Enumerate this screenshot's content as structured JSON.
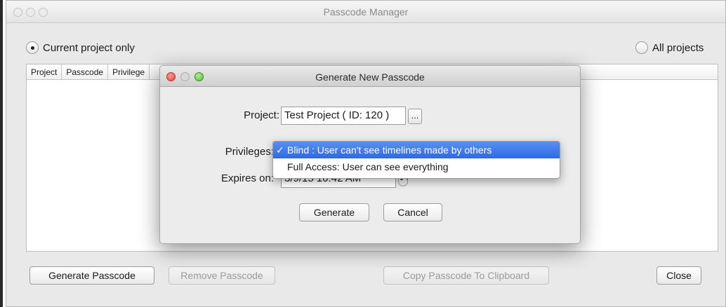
{
  "main": {
    "title": "Passcode Manager",
    "radio_current": "Current project only",
    "radio_all": "All projects",
    "columns": [
      "Project",
      "Passcode",
      "Privilege"
    ],
    "buttons": {
      "generate": "Generate Passcode",
      "remove": "Remove Passcode",
      "copy": "Copy Passcode To Clipboard",
      "close": "Close"
    }
  },
  "dialog": {
    "title": "Generate New Passcode",
    "project_label": "Project:",
    "project_value": "Test Project ( ID: 120 )",
    "ellipsis": "...",
    "privileges_label": "Privileges:",
    "expires_label": "Expires on:",
    "expires_value": "3/9/15 10:42 AM",
    "generate_btn": "Generate",
    "cancel_btn": "Cancel"
  },
  "privileges_menu": {
    "checkmark": "✓",
    "options": [
      "Blind : User can't see timelines made by others",
      "Full Access:  User can see everything"
    ],
    "selected_index": 0
  }
}
